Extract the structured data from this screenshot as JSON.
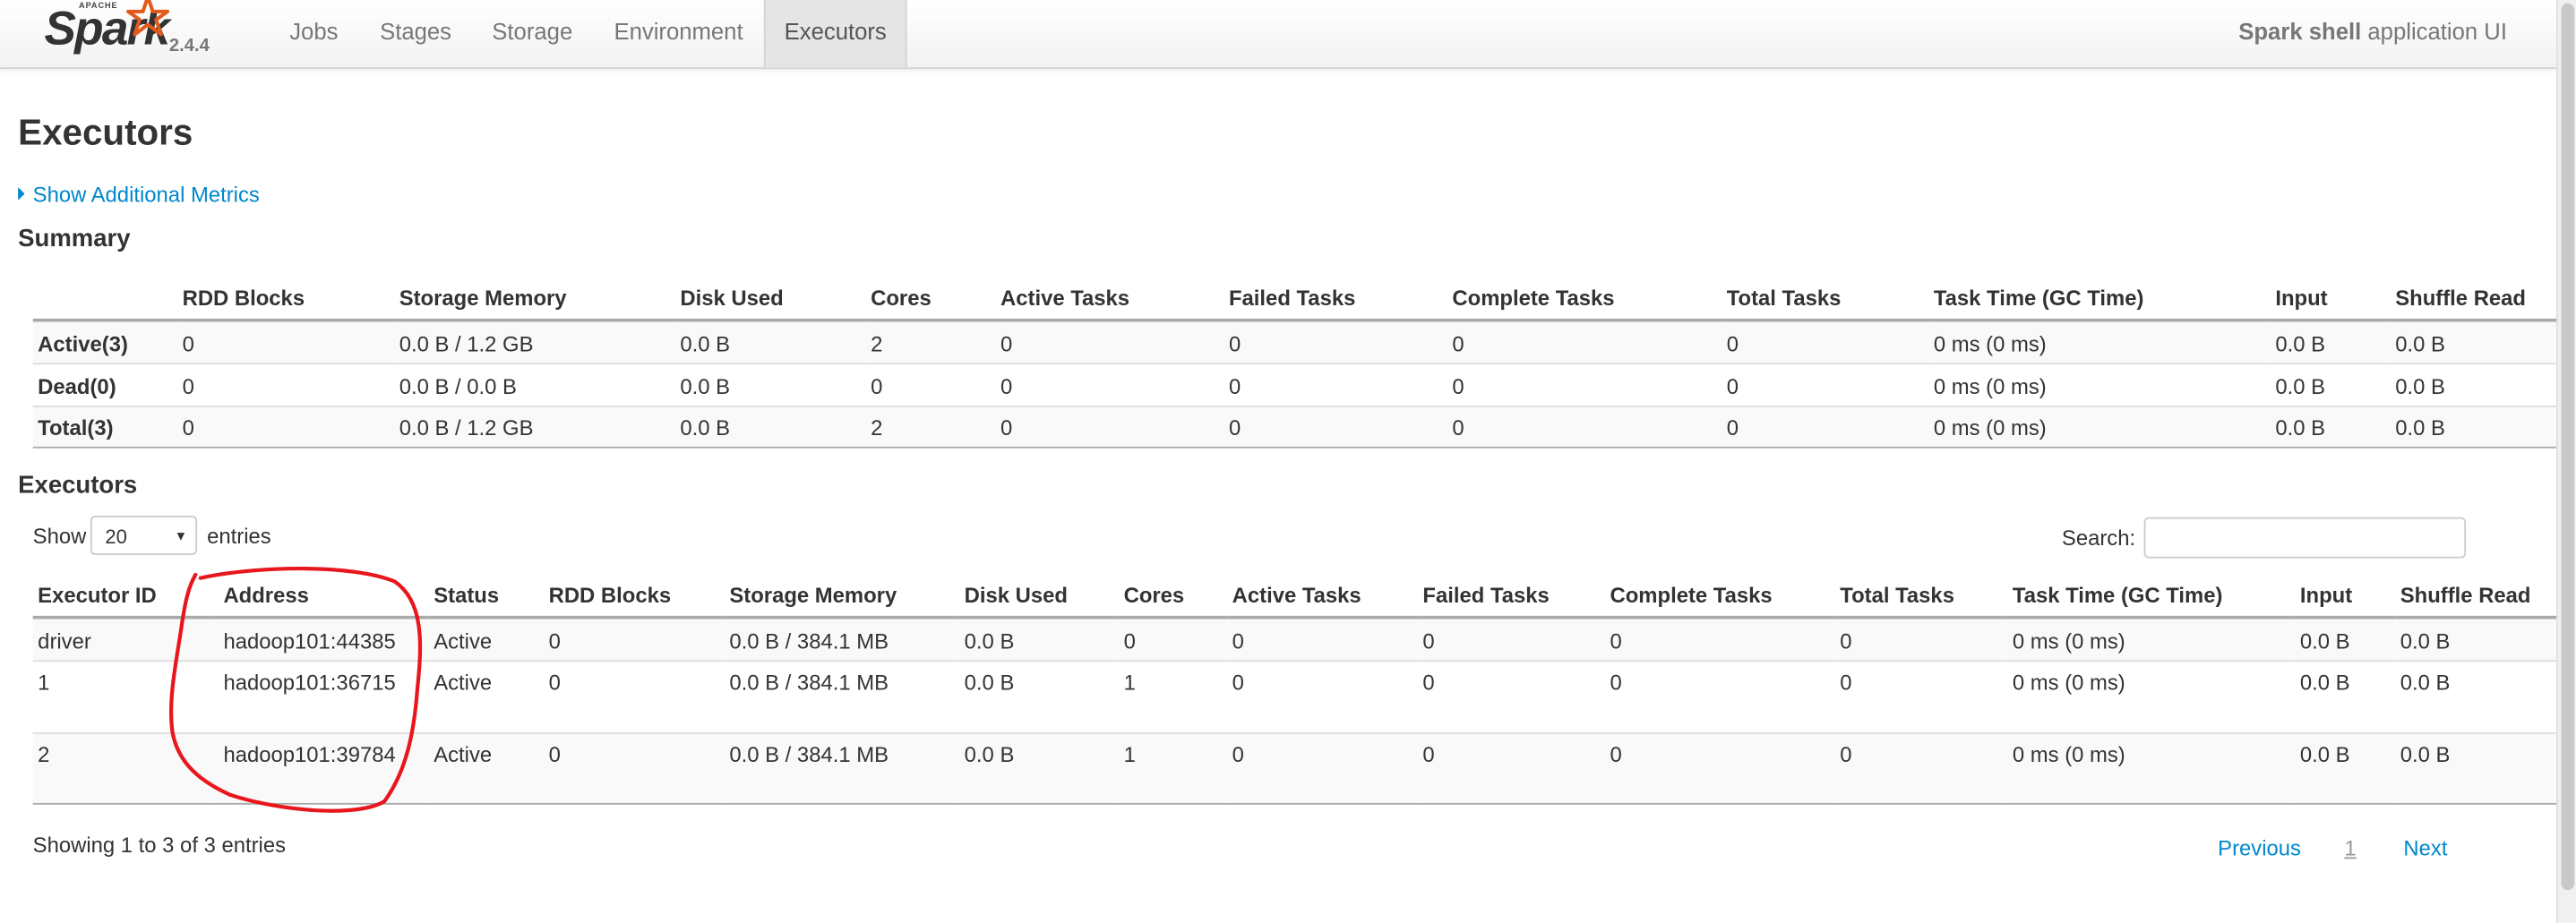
{
  "brand": {
    "apache": "APACHE",
    "name": "Spark",
    "version": "2.4.4"
  },
  "nav": {
    "tabs": [
      "Jobs",
      "Stages",
      "Storage",
      "Environment",
      "Executors"
    ],
    "active": "Executors",
    "app_name": "Spark shell",
    "app_suffix": " application UI"
  },
  "page": {
    "title": "Executors",
    "metrics_link": "Show Additional Metrics"
  },
  "summary": {
    "title": "Summary",
    "columns": [
      "",
      "RDD Blocks",
      "Storage Memory",
      "Disk Used",
      "Cores",
      "Active Tasks",
      "Failed Tasks",
      "Complete Tasks",
      "Total Tasks",
      "Task Time (GC Time)",
      "Input",
      "Shuffle Read"
    ],
    "rows": [
      [
        "Active(3)",
        "0",
        "0.0 B / 1.2 GB",
        "0.0 B",
        "2",
        "0",
        "0",
        "0",
        "0",
        "0 ms (0 ms)",
        "0.0 B",
        "0.0 B"
      ],
      [
        "Dead(0)",
        "0",
        "0.0 B / 0.0 B",
        "0.0 B",
        "0",
        "0",
        "0",
        "0",
        "0",
        "0 ms (0 ms)",
        "0.0 B",
        "0.0 B"
      ],
      [
        "Total(3)",
        "0",
        "0.0 B / 1.2 GB",
        "0.0 B",
        "2",
        "0",
        "0",
        "0",
        "0",
        "0 ms (0 ms)",
        "0.0 B",
        "0.0 B"
      ]
    ]
  },
  "executors": {
    "title": "Executors",
    "show_label": "Show",
    "page_size": "20",
    "entries_label": "entries",
    "search_label": "Search:",
    "search_value": "",
    "columns": [
      "Executor ID",
      "Address",
      "Status",
      "RDD Blocks",
      "Storage Memory",
      "Disk Used",
      "Cores",
      "Active Tasks",
      "Failed Tasks",
      "Complete Tasks",
      "Total Tasks",
      "Task Time (GC Time)",
      "Input",
      "Shuffle Read"
    ],
    "rows": [
      [
        "driver",
        "hadoop101:44385",
        "Active",
        "0",
        "0.0 B / 384.1 MB",
        "0.0 B",
        "0",
        "0",
        "0",
        "0",
        "0",
        "0 ms (0 ms)",
        "0.0 B",
        "0.0 B"
      ],
      [
        "1",
        "hadoop101:36715",
        "Active",
        "0",
        "0.0 B / 384.1 MB",
        "0.0 B",
        "1",
        "0",
        "0",
        "0",
        "0",
        "0 ms (0 ms)",
        "0.0 B",
        "0.0 B"
      ],
      [
        "2",
        "hadoop101:39784",
        "Active",
        "0",
        "0.0 B / 384.1 MB",
        "0.0 B",
        "1",
        "0",
        "0",
        "0",
        "0",
        "0 ms (0 ms)",
        "0.0 B",
        "0.0 B"
      ]
    ],
    "info": "Showing 1 to 3 of 3 entries",
    "pager": {
      "previous": "Previous",
      "current": "1",
      "next": "Next"
    }
  },
  "colors": {
    "link": "#0088cc",
    "annotation": "#e8161d",
    "header_rule": "#aaaaaa"
  }
}
